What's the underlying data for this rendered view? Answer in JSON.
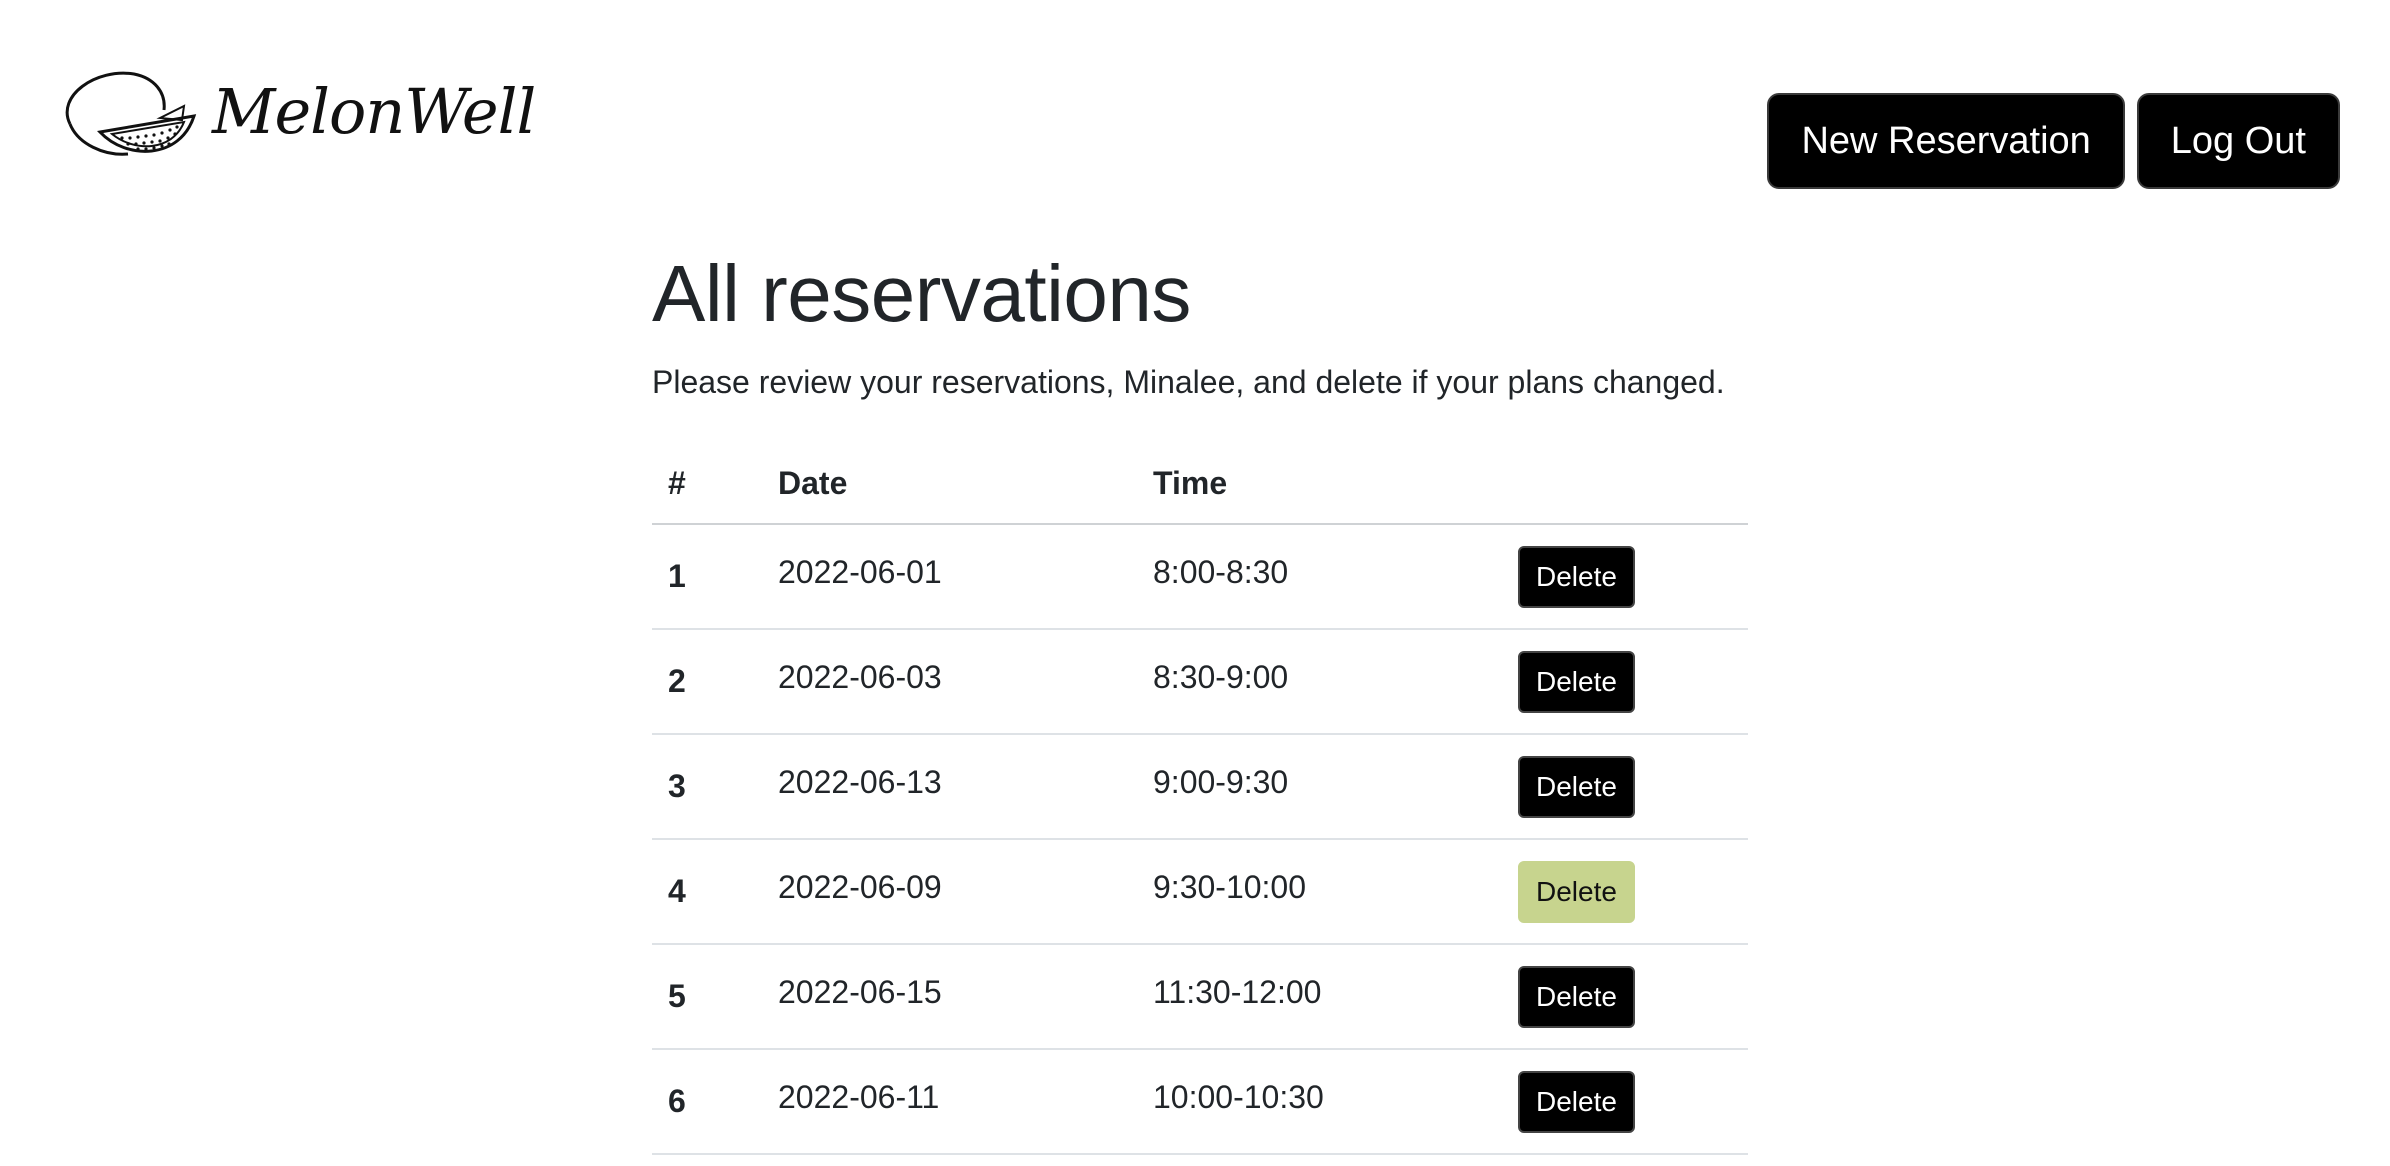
{
  "brand": {
    "name": "MelonWell",
    "logo_icon": "watermelon-slice-icon"
  },
  "nav": {
    "new_reservation_label": "New Reservation",
    "logout_label": "Log Out"
  },
  "main": {
    "title": "All reservations",
    "subtitle": "Please review your reservations, Minalee, and delete if your plans changed."
  },
  "table": {
    "headers": [
      "#",
      "Date",
      "Time",
      ""
    ],
    "rows": [
      {
        "num": "1",
        "date": "2022-06-01",
        "time": "8:00-8:30",
        "action": "Delete"
      },
      {
        "num": "2",
        "date": "2022-06-03",
        "time": "8:30-9:00",
        "action": "Delete"
      },
      {
        "num": "3",
        "date": "2022-06-13",
        "time": "9:00-9:30",
        "action": "Delete"
      },
      {
        "num": "4",
        "date": "2022-06-09",
        "time": "9:30-10:00",
        "action": "Delete",
        "highlighted": true
      },
      {
        "num": "5",
        "date": "2022-06-15",
        "time": "11:30-12:00",
        "action": "Delete"
      },
      {
        "num": "6",
        "date": "2022-06-11",
        "time": "10:00-10:30",
        "action": "Delete"
      }
    ]
  },
  "colors": {
    "button_bg": "#000000",
    "button_hover_bg": "#c7d48e",
    "text": "#212529"
  }
}
